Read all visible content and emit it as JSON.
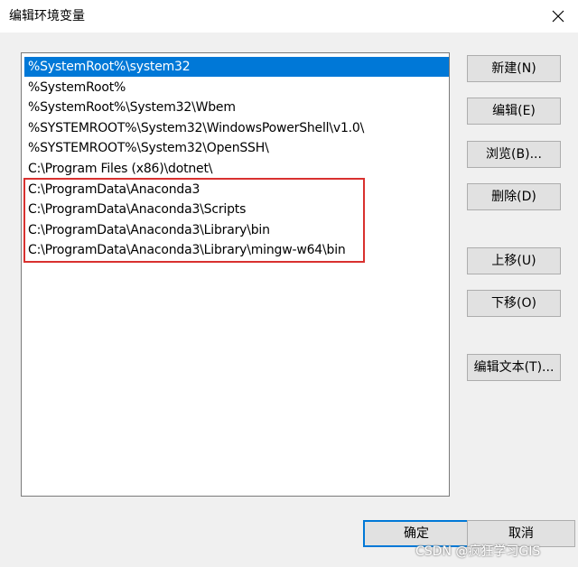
{
  "window": {
    "title": "编辑环境变量"
  },
  "path_list": {
    "items": [
      {
        "text": "%SystemRoot%\\system32",
        "selected": true
      },
      {
        "text": "%SystemRoot%",
        "selected": false
      },
      {
        "text": "%SystemRoot%\\System32\\Wbem",
        "selected": false
      },
      {
        "text": "%SYSTEMROOT%\\System32\\WindowsPowerShell\\v1.0\\",
        "selected": false
      },
      {
        "text": "%SYSTEMROOT%\\System32\\OpenSSH\\",
        "selected": false
      },
      {
        "text": "C:\\Program Files (x86)\\dotnet\\",
        "selected": false
      },
      {
        "text": "C:\\ProgramData\\Anaconda3",
        "selected": false
      },
      {
        "text": "C:\\ProgramData\\Anaconda3\\Scripts",
        "selected": false
      },
      {
        "text": "C:\\ProgramData\\Anaconda3\\Library\\bin",
        "selected": false
      },
      {
        "text": "C:\\ProgramData\\Anaconda3\\Library\\mingw-w64\\bin",
        "selected": false
      }
    ]
  },
  "buttons": {
    "new": "新建(N)",
    "edit": "编辑(E)",
    "browse": "浏览(B)...",
    "delete": "删除(D)",
    "move_up": "上移(U)",
    "move_down": "下移(O)",
    "edit_text": "编辑文本(T)...",
    "ok": "确定",
    "cancel": "取消"
  },
  "watermark": "CSDN @疯狂学习GIS",
  "colors": {
    "selection": "#0078d7",
    "highlight_box": "#d9312f"
  }
}
